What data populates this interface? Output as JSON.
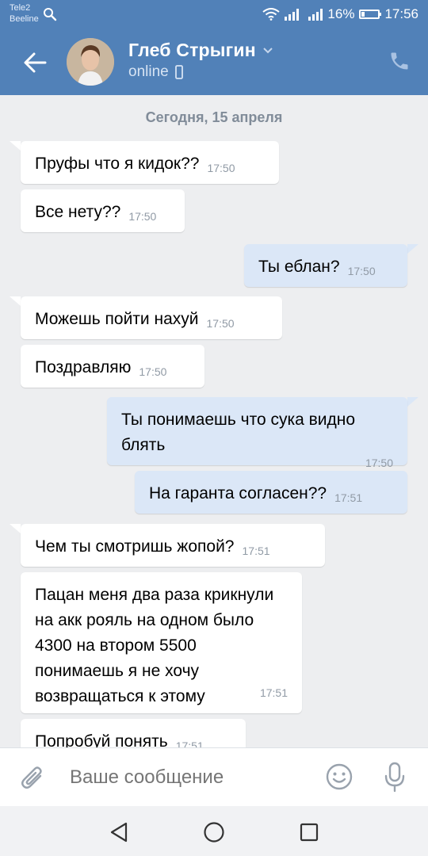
{
  "status_bar": {
    "carrier1": "Tele2",
    "carrier2": "Beeline",
    "battery": "16%",
    "time": "17:56"
  },
  "header": {
    "contact_name": "Глеб Стрыгин",
    "status": "online",
    "bg_color": "#5181b8"
  },
  "chat": {
    "date_label": "Сегодня, 15 апреля",
    "messages": [
      {
        "dir": "in",
        "text": "Пруфы что я кидок??",
        "time": "17:50"
      },
      {
        "dir": "in",
        "text": "Все нету??",
        "time": "17:50"
      },
      {
        "dir": "out",
        "text": "Ты еблан?",
        "time": "17:50"
      },
      {
        "dir": "in",
        "text": "Можешь пойти нахуй",
        "time": "17:50"
      },
      {
        "dir": "in",
        "text": "Поздравляю",
        "time": "17:50"
      },
      {
        "dir": "out",
        "text": "Ты понимаешь что сука видно блять",
        "time": "17:50"
      },
      {
        "dir": "out",
        "text": "На гаранта согласен??",
        "time": "17:51"
      },
      {
        "dir": "in",
        "text": "Чем ты смотришь жопой?",
        "time": "17:51"
      },
      {
        "dir": "in",
        "text": "Пацан меня два раза крикнули на акк рояль на одном было 4300 на втором 5500 понимаешь я не хочу возвращаться к этому",
        "time": "17:51"
      },
      {
        "dir": "in",
        "text": "Попробуй понять",
        "time": "17:51"
      }
    ]
  },
  "input": {
    "placeholder": "Ваше сообщение"
  },
  "icons": {
    "back": "arrow-left-icon",
    "call": "phone-icon",
    "attach": "paperclip-icon",
    "emoji": "smiley-icon",
    "mic": "microphone-icon"
  }
}
